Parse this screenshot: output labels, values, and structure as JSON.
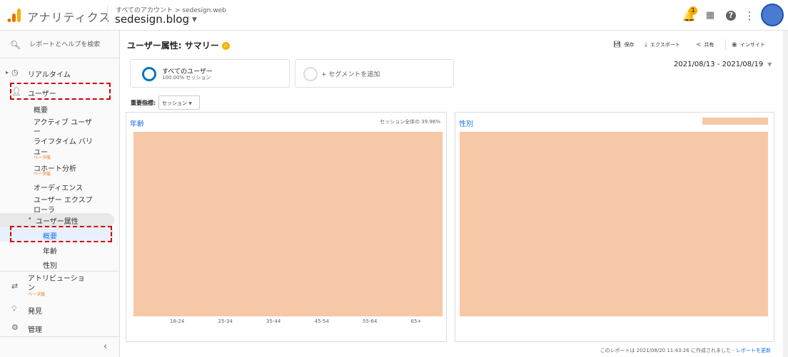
{
  "header": {
    "app_name": "アナリティクス",
    "breadcrumb": "すべてのアカウント > sedesign.web",
    "property": "sedesign.blog",
    "notification_count": "1"
  },
  "sidebar": {
    "search_placeholder": "レポートとヘルプを検索",
    "realtime": "リアルタイム",
    "users": "ユーザー",
    "sub_overview": "概要",
    "sub_active_users_1": "アクティブ ユーザ",
    "sub_active_users_2": "ー",
    "sub_lifetime_1": "ライフタイム バリ",
    "sub_lifetime_2": "ユー",
    "beta": "ベータ版",
    "sub_cohort": "コホート分析",
    "sub_audience": "オーディエンス",
    "sub_explorer_1": "ユーザー エクスプ",
    "sub_explorer_2": "ローラ",
    "user_attributes": "ユーザー属性",
    "attr_overview": "概要",
    "attr_age": "年齢",
    "attr_gender": "性別",
    "attribution_1": "アトリビューショ",
    "attribution_2": "ン",
    "discover": "発見",
    "admin": "管理"
  },
  "main": {
    "title": "ユーザー属性: サマリー",
    "toolbar": {
      "save": "保存",
      "export": "エクスポート",
      "share": "共有",
      "insight": "インサイト"
    },
    "segments": [
      {
        "name": "すべてのユーザー",
        "sub": "100.00% セッション"
      },
      {
        "add": "+ セグメントを追加"
      }
    ],
    "date_range": "2021/08/13 - 2021/08/19",
    "metric_label": "重要指標:",
    "metric_value": "セッション",
    "panels": {
      "age": {
        "title": "年齢",
        "note": "セッション全体の 39.96%"
      },
      "gender": {
        "title": "性別"
      }
    },
    "footer_text": "このレポートは 2021/08/20 11:43:26 に作成されました -",
    "footer_link": "レポートを更新"
  },
  "chart_data": {
    "type": "bar",
    "title": "年齢",
    "categories": [
      "18-24",
      "25-34",
      "35-44",
      "45-54",
      "55-64",
      "65+"
    ]
  },
  "colors": {
    "accent": "#1a73e8",
    "placeholder": "#f6c8a7",
    "highlight_box": "#d10000",
    "beta": "#e8710a"
  }
}
